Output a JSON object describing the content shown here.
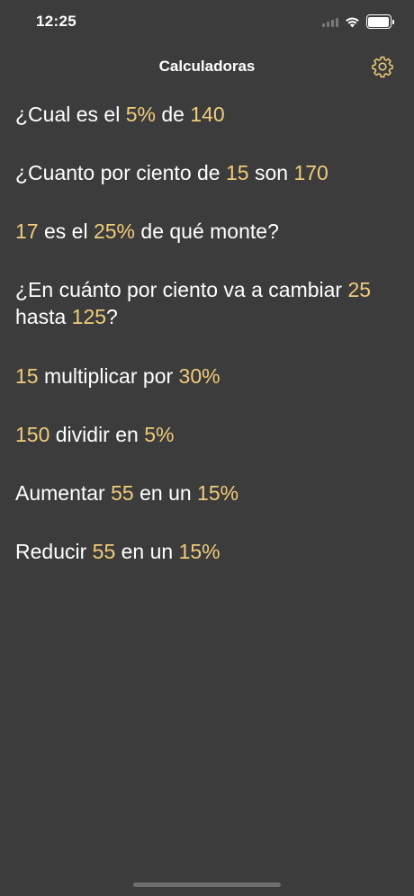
{
  "status_bar": {
    "time": "12:25",
    "icons": [
      "signal-icon",
      "wifi-icon",
      "battery-icon"
    ]
  },
  "nav": {
    "title": "Calculadoras",
    "settings_icon": "gear-icon"
  },
  "colors": {
    "background": "#3c3c3c",
    "text": "#ffffff",
    "accent": "#f0cc7a"
  },
  "calculators": [
    {
      "parts": [
        {
          "t": "¿Cual es el ",
          "hl": false
        },
        {
          "t": "5%",
          "hl": true
        },
        {
          "t": " de ",
          "hl": false
        },
        {
          "t": "140",
          "hl": true
        }
      ]
    },
    {
      "parts": [
        {
          "t": "¿Cuanto por ciento de ",
          "hl": false
        },
        {
          "t": "15",
          "hl": true
        },
        {
          "t": " son ",
          "hl": false
        },
        {
          "t": "170",
          "hl": true
        }
      ]
    },
    {
      "parts": [
        {
          "t": "17",
          "hl": true
        },
        {
          "t": " es el ",
          "hl": false
        },
        {
          "t": "25%",
          "hl": true
        },
        {
          "t": " de qué monte?",
          "hl": false
        }
      ]
    },
    {
      "parts": [
        {
          "t": "¿En cuánto por ciento va a cambiar ",
          "hl": false
        },
        {
          "t": "25",
          "hl": true
        },
        {
          "t": " hasta ",
          "hl": false
        },
        {
          "t": "125",
          "hl": true
        },
        {
          "t": "?",
          "hl": false
        }
      ]
    },
    {
      "parts": [
        {
          "t": "15",
          "hl": true
        },
        {
          "t": " multiplicar por ",
          "hl": false
        },
        {
          "t": "30%",
          "hl": true
        }
      ]
    },
    {
      "parts": [
        {
          "t": "150",
          "hl": true
        },
        {
          "t": " dividir en ",
          "hl": false
        },
        {
          "t": "5%",
          "hl": true
        }
      ]
    },
    {
      "parts": [
        {
          "t": "Aumentar ",
          "hl": false
        },
        {
          "t": "55",
          "hl": true
        },
        {
          "t": " en un ",
          "hl": false
        },
        {
          "t": "15%",
          "hl": true
        }
      ]
    },
    {
      "parts": [
        {
          "t": "Reducir ",
          "hl": false
        },
        {
          "t": "55",
          "hl": true
        },
        {
          "t": " en un ",
          "hl": false
        },
        {
          "t": "15%",
          "hl": true
        }
      ]
    }
  ]
}
